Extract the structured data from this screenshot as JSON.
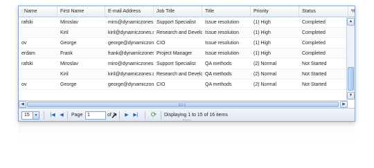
{
  "columns": [
    ": Name",
    "First Name",
    "E-mail Address",
    "Job Title",
    "Title",
    "Priority",
    "Status",
    "%"
  ],
  "rows": [
    {
      "last": "rafski",
      "first": "Miroslav",
      "email": "miro@dynamiczones.c",
      "job": "Support Specialist",
      "title": "Issue resolution",
      "priority": "(1) High",
      "status": "Completed"
    },
    {
      "last": "",
      "first": "Kiril",
      "email": "kiril@dynamiczones.c",
      "job": "Research and Develop",
      "title": "Issue resolution",
      "priority": "(1) High",
      "status": "Completed"
    },
    {
      "last": "ov",
      "first": "George",
      "email": "george@dynamiczone",
      "job": "CIO",
      "title": "Issue resolution",
      "priority": "(1) High",
      "status": "Completed"
    },
    {
      "last": "erdam",
      "first": "Frank",
      "email": "frank@dynamiczones.",
      "job": "Project Manager",
      "title": "Issue resolution",
      "priority": "(1) High",
      "status": "Completed"
    },
    {
      "last": "rafski",
      "first": "Miroslav",
      "email": "miro@dynamiczones.c",
      "job": "Support Specialist",
      "title": "QA methods",
      "priority": "(2) Normal",
      "status": "Not Started"
    },
    {
      "last": "",
      "first": "Kiril",
      "email": "kiril@dynamiczones.c",
      "job": "Research and Develop",
      "title": "QA methods",
      "priority": "(2) Normal",
      "status": "Not Started"
    },
    {
      "last": "ov",
      "first": "George",
      "email": "george@dynamiczone",
      "job": "CIO",
      "title": "QA methods",
      "priority": "(2) Normal",
      "status": "Not Started"
    }
  ],
  "pager": {
    "page_size": "15",
    "page_label": "Page",
    "page_value": "1",
    "of_label": "of 2",
    "display_text": "Displaying 1 to 15 of 16 items"
  },
  "icons": {
    "first": "first-page-icon",
    "prev": "prev-page-icon",
    "next": "next-page-icon",
    "last": "last-page-icon",
    "refresh": "refresh-icon"
  },
  "colors": {
    "border": "#8aa5c9",
    "nav": "#2a63b8",
    "refresh": "#3a9a3a"
  }
}
